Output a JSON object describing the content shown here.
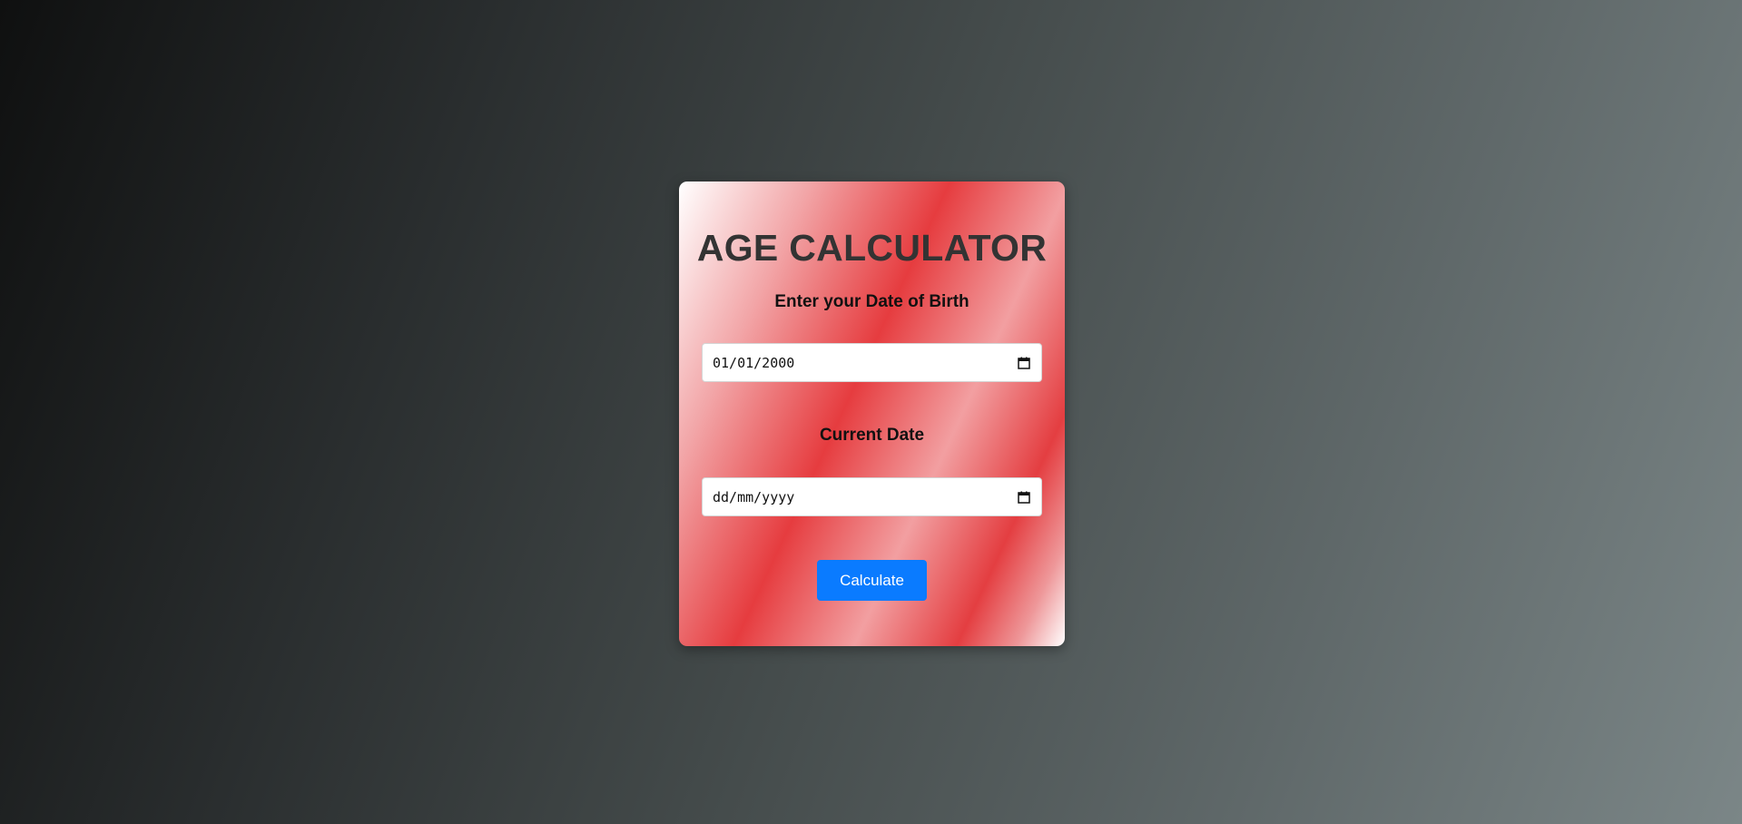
{
  "app": {
    "title": "AGE CALCULATOR"
  },
  "dob": {
    "label": "Enter your Date of Birth",
    "value": "01/01/2000",
    "icon": "calendar-icon"
  },
  "current": {
    "label": "Current Date",
    "placeholder": "dd/mm/yyyy",
    "icon": "calendar-icon"
  },
  "actions": {
    "calculate_label": "Calculate"
  },
  "colors": {
    "accent": "#0a7bff",
    "card_red": "#e63c3f",
    "title": "#333333"
  }
}
